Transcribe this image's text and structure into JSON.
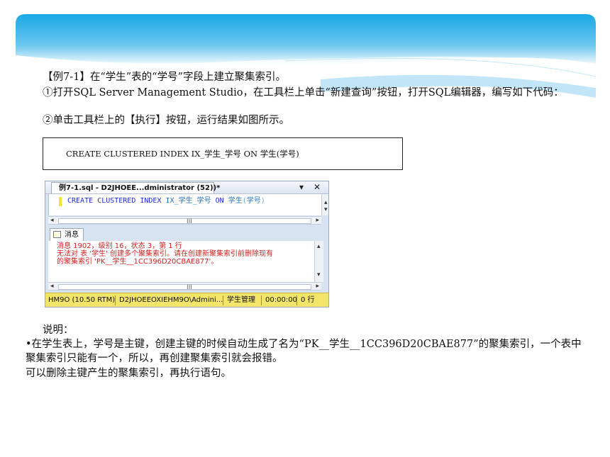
{
  "slide": {
    "example_heading": "【例7-1】在“学生”表的“学号”字段上建立聚集索引。",
    "step1": "①打开SQL Server Management Studio，在工具栏上单击“新建查询”按钮，打开SQL编辑器，编写如下代码：",
    "step2": "②单击工具栏上的【执行】按钮，运行结果如图所示。",
    "code": "CREATE CLUSTERED INDEX IX_学生_学号 ON 学生(学号)",
    "note_title": "说明：",
    "note_bullet": "•在学生表上，学号是主键，创建主键的时候自动生成了名为“PK__学生__1CC396D20CBAE877”的聚集索引，一个表中聚集索引只能有一个，所以，再创建聚集索引就会报错。",
    "note_last": "可以删除主键产生的聚集索引，再执行语句。"
  },
  "ssms": {
    "tab_title": "例7-1.sql - D2JHOEE...dministrator (52))*",
    "dropdown_icon": "▾",
    "close_icon": "✕",
    "code_tokens": {
      "kw1": "CREATE",
      "cursor_char": "C",
      "kw2": "LUSTERED INDEX",
      "name": "IX_学生_学号",
      "kw3": "ON",
      "table": "学生",
      "col_open": "(",
      "col": "学号",
      "col_close": ")"
    },
    "messages_tab": "消息",
    "messages": {
      "line1": "消息 1902，级别 16，状态 3，第 1 行",
      "line2": "无法对 表 '学生' 创建多个聚集索引。请在创建新聚集索引前删除现有",
      "line3": "的聚集索引 'PK__学生__1CC396D20CBAE877'。"
    },
    "status": {
      "server": "HM9O (10.50 RTM)",
      "login": "D2JHOEEOXIEHM9O\\Admini...",
      "database": "学生管理",
      "elapsed": "00:00:00",
      "rows": "0 行"
    },
    "scroll_grip": "III"
  }
}
